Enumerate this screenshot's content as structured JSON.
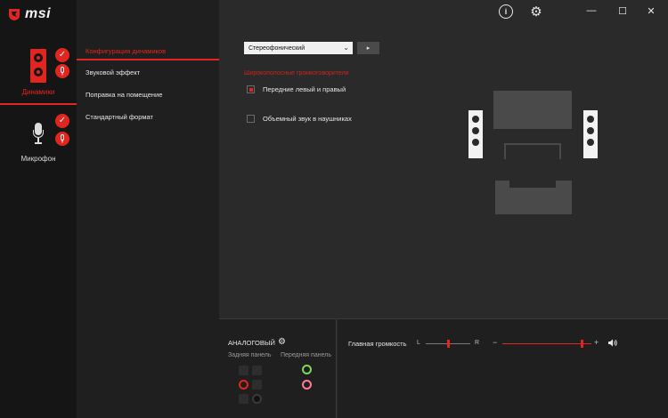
{
  "brand": {
    "name": "msi"
  },
  "devices": [
    {
      "label": "Динамики",
      "active": true
    },
    {
      "label": "Микрофон",
      "active": false
    }
  ],
  "menu": [
    {
      "label": "Конфигурация динамиков",
      "active": true
    },
    {
      "label": "Звуковой эффект",
      "active": false
    },
    {
      "label": "Поправка на помещение",
      "active": false
    },
    {
      "label": "Стандартный формат",
      "active": false
    }
  ],
  "config": {
    "mode_value": "Стереофонический",
    "section_title": "Широкополосные громкоговорители",
    "options": [
      {
        "label": "Передние левый и правый",
        "checked": true
      },
      {
        "label": "Объемный звук в наушниках",
        "checked": false
      }
    ]
  },
  "analog": {
    "title": "АНАЛОГОВЫЙ",
    "rear_label": "Задняя панель",
    "front_label": "Передняя панель",
    "front_jack_colors": [
      "#7ed957",
      "#ff7a9c"
    ]
  },
  "volume": {
    "label": "Главная громкость",
    "left_marker": "L",
    "right_marker": "R",
    "minus": "−",
    "plus": "+",
    "balance": 0.5,
    "master_level": 0.89
  },
  "colors": {
    "accent": "#e0261f",
    "background": "#2a2a2a"
  }
}
